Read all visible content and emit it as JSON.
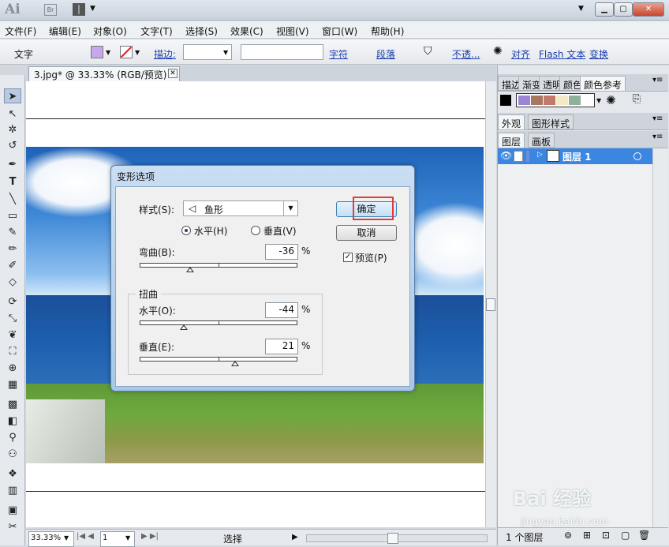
{
  "app": {
    "logo": "Ai",
    "bridge": "Br"
  },
  "menu": [
    "文件(F)",
    "编辑(E)",
    "对象(O)",
    "文字(T)",
    "选择(S)",
    "效果(C)",
    "视图(V)",
    "窗口(W)",
    "帮助(H)"
  ],
  "control": {
    "tool_label": "文字",
    "stroke_label": "描边:",
    "char_link": "字符",
    "para_link": "段落",
    "opacity_link": "不透...",
    "align_link": "对齐",
    "flash_link": "Flash 文本",
    "transform_link": "变换",
    "fill_color": "#c8a8ec"
  },
  "document": {
    "tab_title": "3.jpg* @ 33.33% (RGB/预览)",
    "close": "✕"
  },
  "status": {
    "zoom": "33.33%",
    "page": "1",
    "tool": "选择"
  },
  "panels": {
    "top_tabs": [
      "描边",
      "渐变",
      "透明",
      "颜色",
      "颜色参考"
    ],
    "swatches": [
      "#9b86d6",
      "#a9775e",
      "#c07a6a",
      "#f3e9c4",
      "#8fb09a"
    ],
    "appearance_tabs": [
      "外观",
      "图形样式"
    ],
    "layer_tabs": [
      "图层",
      "画板"
    ],
    "layer_name": "图层 1",
    "layer_count": "1 个图层"
  },
  "dialog": {
    "title": "变形选项",
    "style_label": "样式(S):",
    "style_value": "鱼形",
    "horizontal_radio": "水平(H)",
    "vertical_radio": "垂直(V)",
    "bend_label": "弯曲(B):",
    "bend_value": "-36",
    "distortion_group": "扭曲",
    "h_distort_label": "水平(O):",
    "h_distort_value": "-44",
    "v_distort_label": "垂直(E):",
    "v_distort_value": "21",
    "percent": "%",
    "ok": "确定",
    "cancel": "取消",
    "preview": "预览(P)"
  },
  "watermark": {
    "brand": "Bai 经验",
    "url": "jingyan.baidu.com"
  }
}
